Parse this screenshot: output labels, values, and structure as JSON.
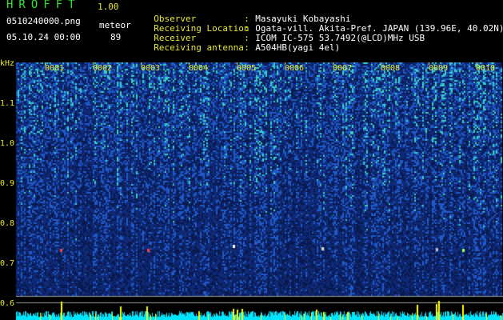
{
  "header": {
    "app_name": "HROFFT",
    "version": "1.00",
    "file_name": "0510240000.png",
    "datetime": "05.10.24 00:00",
    "meteor_label": "meteor",
    "meteor_count": "89"
  },
  "station_info": [
    {
      "key": "Observer",
      "value": "Masayuki Kobayashi"
    },
    {
      "key": "Receiving Location",
      "value": "Ogata-vill. Akita-Pref. JAPAN (139.96E, 40.02N)"
    },
    {
      "key": "Receiver",
      "value": "ICOM IC-575 53.7492(@LCD)MHz USB"
    },
    {
      "key": "Receiving antenna",
      "value": "A504HB(yagi 4el)"
    }
  ],
  "axes": {
    "y_unit": "kHz",
    "y_ticks": [
      "1.1",
      "1.0",
      "0.9",
      "0.8",
      "0.7",
      "0.6"
    ],
    "x_ticks": [
      "0001",
      "0002",
      "0003",
      "0004",
      "0005",
      "0006",
      "0007",
      "0008",
      "0009",
      "0010"
    ]
  },
  "colors": {
    "background": "#000000",
    "label": "#e8e82e",
    "title": "#2ee82e",
    "noise_dark": "#102a78",
    "noise_mid": "#1f5ac8",
    "noise_hi": "#3ad0c8",
    "trace_bar": "#00e5ff",
    "signal_bar": "#ffff00"
  }
}
